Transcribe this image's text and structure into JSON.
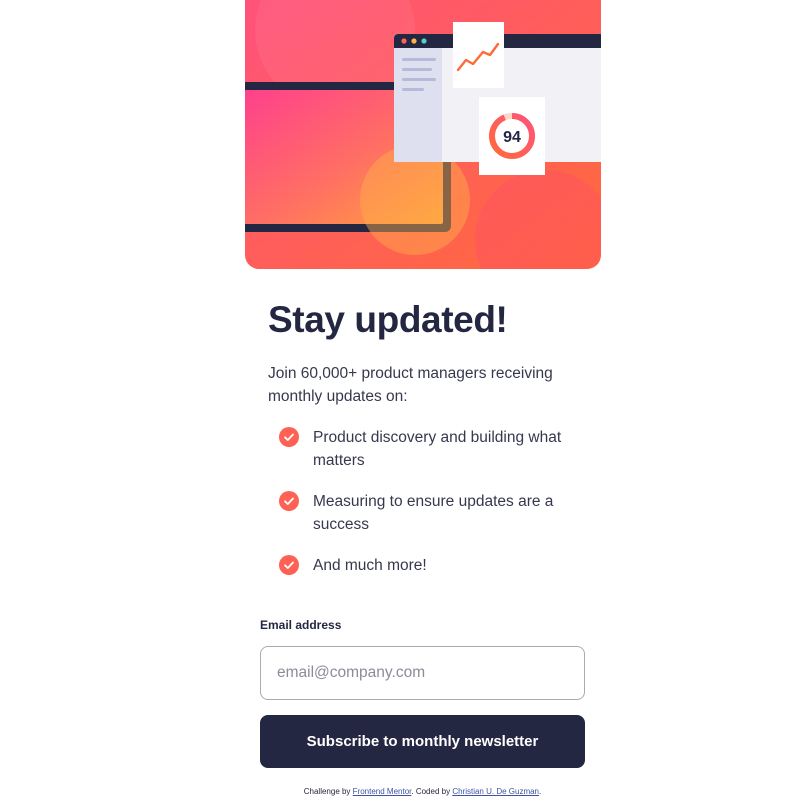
{
  "hero": {
    "score": "94",
    "colors": {
      "gradient_start": "#ff527b",
      "gradient_end": "#ff6a3a",
      "navy": "#242742"
    }
  },
  "main": {
    "headline": "Stay updated!",
    "intro": "Join 60,000+ product managers receiving monthly updates on:",
    "check_icon": "check-circle-icon",
    "features": [
      "Product discovery and building what matters",
      "Measuring to ensure updates are a success",
      "And much more!"
    ]
  },
  "form": {
    "email_label": "Email address",
    "email_placeholder": "email@company.com",
    "email_value": "",
    "submit_label": "Subscribe to monthly newsletter"
  },
  "attribution": {
    "prefix": "Challenge by",
    "challenge_link": "Frontend Mentor",
    "middle": ". Coded by",
    "author_link": "Christian U. De Guzman",
    "suffix": "."
  },
  "colors": {
    "accent": "#ff6155",
    "dark_navy": "#242742",
    "charcoal": "#36384e"
  }
}
